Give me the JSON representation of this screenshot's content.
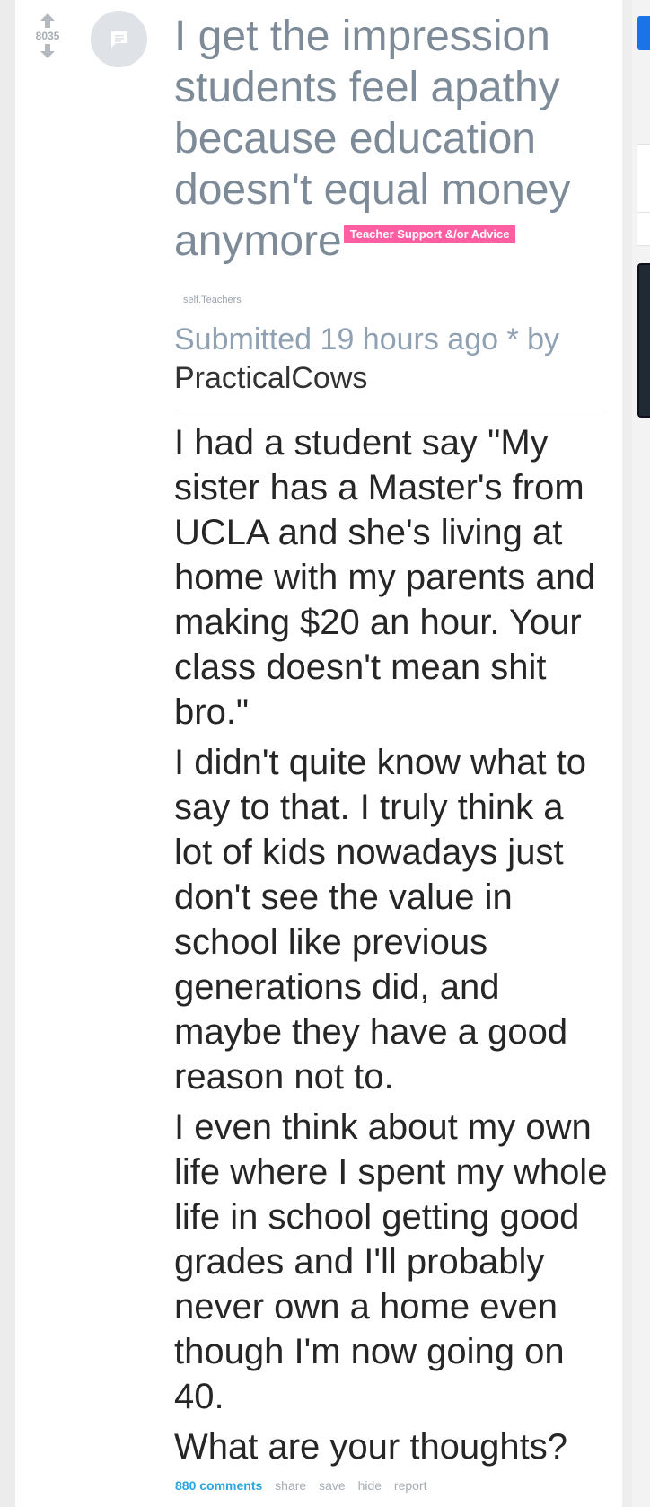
{
  "post": {
    "score": "8035",
    "title": "I get the impression students feel apathy because education doesn't equal money anymore",
    "flair": "Teacher Support &/or Advice",
    "domain": "self.Teachers",
    "tagline": {
      "submitted": "Submitted 19 hours ago * by",
      "author": "PracticalCows"
    },
    "body": [
      "I had a student say \"My sister has a Master's from UCLA and she's living at home with my parents and making $20 an hour. Your class doesn't mean shit bro.\"",
      "I didn't quite know what to say to that. I truly think a lot of kids nowadays just don't see the value in school like previous generations did, and maybe they have a good reason not to.",
      "I even think about my own life where I spent my whole life in school getting good grades and I'll probably never own a home even though I'm now going on 40.",
      "What are your thoughts?"
    ],
    "actions": {
      "comments": "880 comments",
      "share": "share",
      "save": "save",
      "hide": "hide",
      "report": "report"
    }
  },
  "icons": {
    "upvote": "upvote-arrow-icon",
    "downvote": "downvote-arrow-icon",
    "thumbnail": "self-post-text-icon"
  },
  "colors": {
    "flair_bg": "#ff5fa2",
    "title": "#7d8a98",
    "link": "#2aa5e0",
    "accent_blue": "#1a73e8"
  }
}
